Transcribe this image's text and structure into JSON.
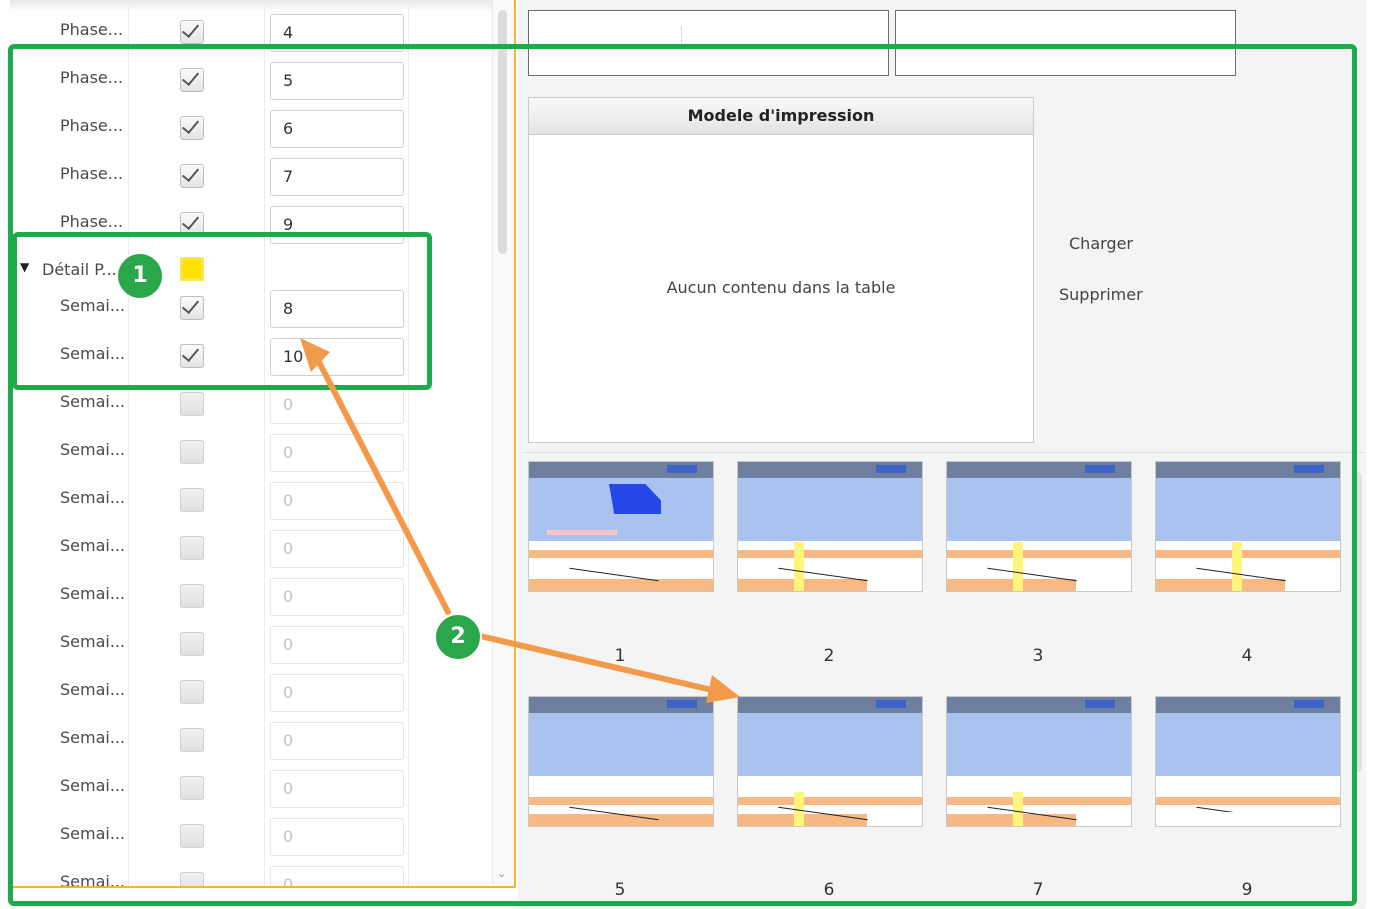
{
  "tree": {
    "rows": [
      {
        "label": "Phase...",
        "checked": true,
        "value": "4",
        "dim": false
      },
      {
        "label": "Phase...",
        "checked": true,
        "value": "5",
        "dim": false
      },
      {
        "label": "Phase...",
        "checked": true,
        "value": "6",
        "dim": false
      },
      {
        "label": "Phase...",
        "checked": true,
        "value": "7",
        "dim": false
      },
      {
        "label": "Phase...",
        "checked": true,
        "value": "9",
        "dim": false
      },
      {
        "label": "Détail P...",
        "group": true,
        "checked": false,
        "highlight": true,
        "value": ""
      },
      {
        "label": "Semai...",
        "checked": true,
        "value": "8",
        "dim": false
      },
      {
        "label": "Semai...",
        "checked": true,
        "value": "10",
        "dim": false
      },
      {
        "label": "Semai...",
        "checked": false,
        "value": "0",
        "dim": true
      },
      {
        "label": "Semai...",
        "checked": false,
        "value": "0",
        "dim": true
      },
      {
        "label": "Semai...",
        "checked": false,
        "value": "0",
        "dim": true
      },
      {
        "label": "Semai...",
        "checked": false,
        "value": "0",
        "dim": true
      },
      {
        "label": "Semai...",
        "checked": false,
        "value": "0",
        "dim": true
      },
      {
        "label": "Semai...",
        "checked": false,
        "value": "0",
        "dim": true
      },
      {
        "label": "Semai...",
        "checked": false,
        "value": "0",
        "dim": true
      },
      {
        "label": "Semai...",
        "checked": false,
        "value": "0",
        "dim": true
      },
      {
        "label": "Semai...",
        "checked": false,
        "value": "0",
        "dim": true
      },
      {
        "label": "Semai...",
        "checked": false,
        "value": "0",
        "dim": true
      },
      {
        "label": "Semai...",
        "checked": false,
        "value": "0",
        "dim": true
      }
    ]
  },
  "print_template": {
    "header": "Modele d'impression",
    "empty_text": "Aucun contenu dans la table"
  },
  "actions": {
    "load_label": "Charger",
    "delete_label": "Supprimer"
  },
  "thumbnails": [
    "1",
    "2",
    "3",
    "4",
    "5",
    "6",
    "7",
    "9"
  ],
  "annotations": {
    "badge1": "1",
    "badge2": "2",
    "green_color": "#1ea94a",
    "arrow_color": "#f29a4a",
    "highlight_color": "#ffe000",
    "splitter_color": "#f3b52a"
  }
}
